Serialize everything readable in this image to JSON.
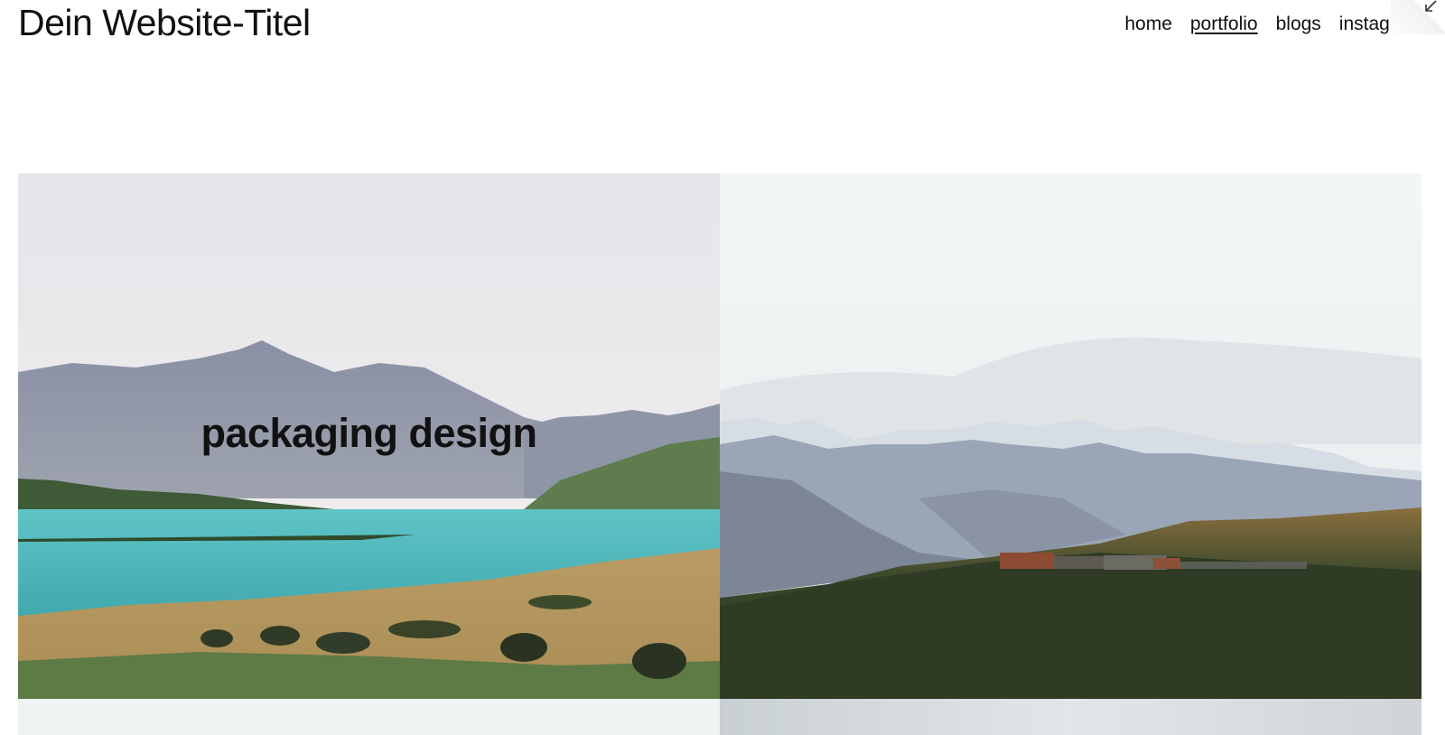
{
  "header": {
    "site_title": "Dein Website-Titel",
    "nav": [
      {
        "label": "home",
        "active": false
      },
      {
        "label": "portfolio",
        "active": true
      },
      {
        "label": "blogs",
        "active": false
      },
      {
        "label": "instagram",
        "active": false
      }
    ]
  },
  "portfolio": {
    "tiles": [
      {
        "caption": "packaging design",
        "image": "mountain-lake-landscape"
      },
      {
        "caption": "",
        "image": "snowy-mountains-landscape"
      },
      {
        "caption": "",
        "image": "pale-sky"
      },
      {
        "caption": "",
        "image": "grey-sky"
      }
    ]
  },
  "colors": {
    "text": "#111111",
    "lake": "#3fb3b6",
    "sky": "#e8ebee",
    "grass": "#b79a62"
  },
  "icons": {
    "corner": "collapse-arrow-icon"
  }
}
